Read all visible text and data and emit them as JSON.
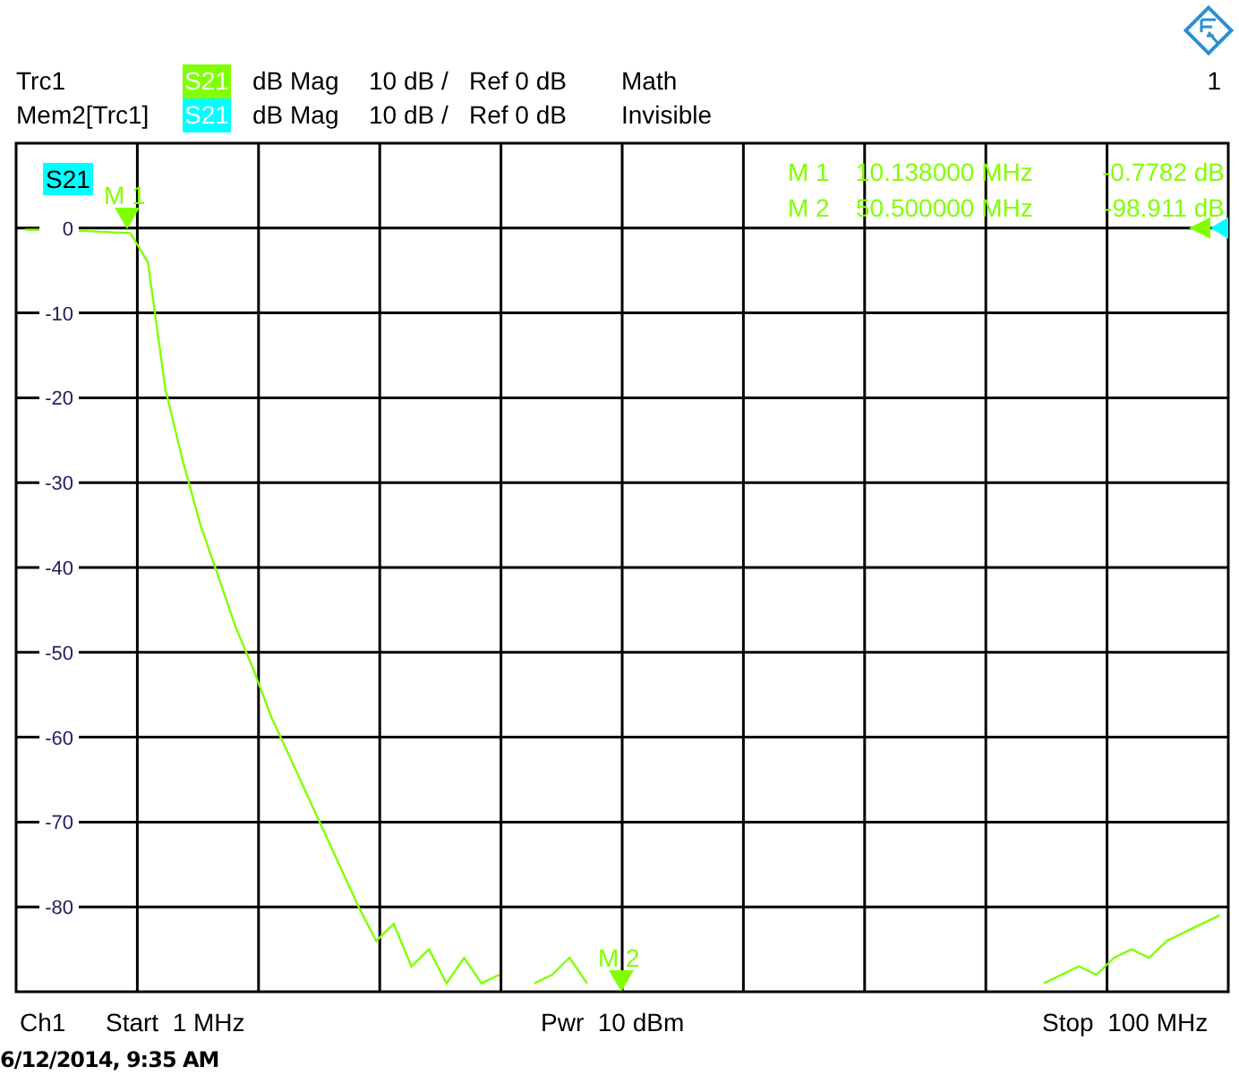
{
  "channel_number": "1",
  "traces": [
    {
      "name": "Trc1",
      "param": "S21",
      "color": "#80ff00",
      "format": "dB Mag",
      "scale": "10 dB /",
      "ref": "Ref 0 dB",
      "state": "Math"
    },
    {
      "name": "Mem2[Trc1]",
      "param": "S21",
      "color": "#00ffff",
      "format": "dB Mag",
      "scale": "10 dB /",
      "ref": "Ref 0 dB",
      "state": "Invisible"
    }
  ],
  "chart": {
    "trace_label": "S21",
    "chart_data": {
      "type": "line",
      "grid": true,
      "ylim": [
        -90,
        10
      ],
      "yticks": [
        0,
        -10,
        -20,
        -30,
        -40,
        -50,
        -60,
        -70,
        -80
      ],
      "categories": [
        null,
        null,
        null,
        null,
        null,
        null,
        null,
        null,
        null,
        null,
        null,
        null,
        null,
        null,
        null,
        null,
        null,
        null,
        null,
        null,
        null,
        null,
        null,
        null,
        null,
        null,
        null,
        null,
        null,
        null,
        null,
        null,
        null,
        null,
        null,
        null,
        null,
        null,
        null,
        null,
        null,
        null,
        null,
        null,
        null,
        null,
        null,
        null,
        null,
        null,
        null,
        null,
        null,
        null,
        null,
        null,
        null,
        null,
        null,
        null,
        null,
        null,
        null,
        null,
        null,
        null,
        null,
        null,
        null
      ],
      "series": [
        {
          "color": "#80ff00",
          "values": [
            -0.19,
            -0.22,
            -0.3,
            -0.3,
            -0.4,
            -0.5,
            -0.6,
            -4,
            -19,
            -27.5,
            -35,
            -41,
            -47,
            -52,
            -57.5,
            -62,
            -66.5,
            -71,
            -75.5,
            -80,
            -84,
            -82,
            -87,
            -85,
            -89,
            -86,
            -89,
            -88,
            null,
            -89,
            -88,
            -86,
            -89,
            null,
            null,
            null,
            null,
            null,
            null,
            null,
            null,
            null,
            null,
            null,
            null,
            null,
            null,
            null,
            null,
            null,
            null,
            null,
            null,
            null,
            null,
            null,
            null,
            null,
            -89,
            -88,
            -87,
            -88,
            -86,
            -85,
            -86,
            -84,
            -83,
            -82,
            -81
          ]
        }
      ]
    },
    "markers": [
      {
        "label": "M 1"
      },
      {
        "label": "M 2"
      }
    ],
    "marker_readout": [
      {
        "name": "M 1",
        "frequency": "10.138000 MHz",
        "value": "-0.7782 dB"
      },
      {
        "name": "M 2",
        "frequency": "50.500000 MHz",
        "value": "-98.911 dB"
      }
    ]
  },
  "footer": {
    "channel": "Ch1",
    "start": "Start  1 MHz",
    "power": "Pwr  10 dBm",
    "stop": "Stop  100 MHz"
  },
  "timestamp": "6/12/2014, 9:35 AM"
}
